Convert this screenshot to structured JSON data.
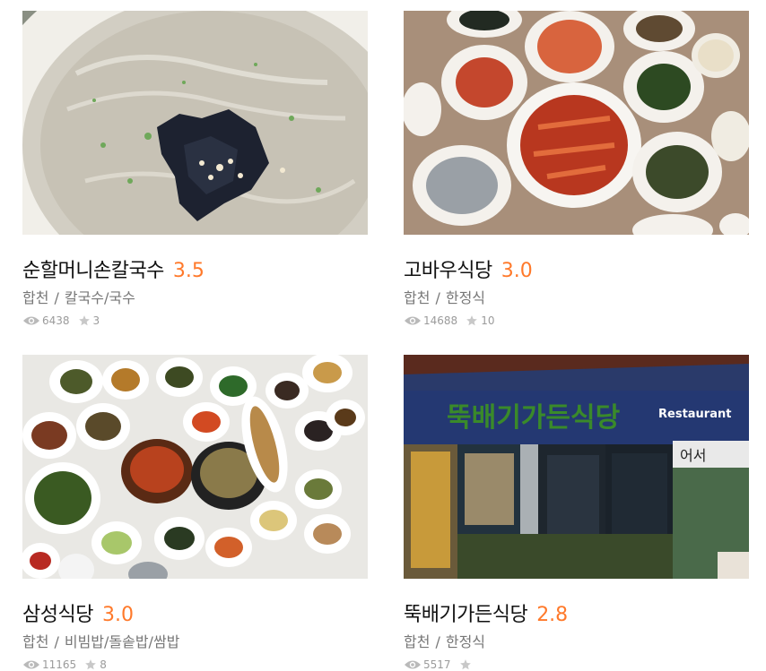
{
  "restaurants": [
    {
      "name": "순할머니손칼국수",
      "rating": "3.5",
      "region": "합천",
      "separator": "/",
      "category": "칼국수/국수",
      "views": "6438",
      "reviews": "3"
    },
    {
      "name": "고바우식당",
      "rating": "3.0",
      "region": "합천",
      "separator": "/",
      "category": "한정식",
      "views": "14688",
      "reviews": "10"
    },
    {
      "name": "삼성식당",
      "rating": "3.0",
      "region": "합천",
      "separator": "/",
      "category": "비빔밥/돌솥밥/쌈밥",
      "views": "11165",
      "reviews": "8"
    },
    {
      "name": "뚝배기가든식당",
      "rating": "2.8",
      "region": "합천",
      "separator": "/",
      "category": "한정식",
      "views": "5517",
      "reviews": ""
    }
  ],
  "sign": {
    "main": "뚝배기가든식당",
    "sub": "Restaurant",
    "side": "어서"
  },
  "colors": {
    "rating": "#ff792a",
    "name": "#111111",
    "meta": "#777777",
    "stats": "#9b9b9b"
  }
}
